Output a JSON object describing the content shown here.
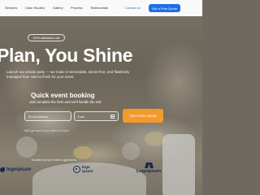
{
  "nav": {
    "links": [
      "Services",
      "Case Studies",
      "Gallery",
      "Process",
      "Testimonials"
    ],
    "contact_label": "Contact us",
    "cta_label": "Get a Free Quote"
  },
  "hero": {
    "badge": "100% satisfaction rate",
    "headline": "Plan, You Shine",
    "subtext": "Launch our private party — we make it memorable, stress-free, and flawlessly managed from start to finish for your event."
  },
  "booking": {
    "title": "Quick event booking",
    "subtitle": "Just complete the form and we'll handle the rest",
    "email_placeholder": "Email Address",
    "date_placeholder": "Date",
    "button_label": "Get a free quote",
    "note": "We'll get back to you within 24 hours"
  },
  "trusted": {
    "label": "Trusted by top event organizers",
    "logos": [
      "logoipsum",
      "logo ipsum",
      "Logoipsum"
    ]
  },
  "colors": {
    "accent_blue": "#1e6fe8",
    "accent_orange": "#f39a2b",
    "logo_navy": "#1a2a52"
  }
}
